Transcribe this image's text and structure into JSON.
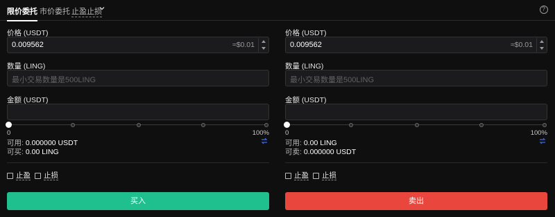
{
  "tabs": {
    "limit": "限价委托",
    "market": "市价委托",
    "stop": "止盈止损"
  },
  "buy": {
    "price_label": "价格 (USDT)",
    "price_value": "0.009562",
    "price_approx": "≈$0.01",
    "amount_label": "数量 (LING)",
    "amount_placeholder": "最小交易数量是500LING",
    "total_label": "金额 (USDT)",
    "total_value": "",
    "slider_min": "0",
    "slider_max": "100%",
    "slider_level": 0,
    "available_label": "可用:",
    "available_value": "0.000000 USDT",
    "can_label": "可买:",
    "can_value": "0.00 LING",
    "take_profit": "止盈",
    "stop_loss": "止损",
    "button": "买入"
  },
  "sell": {
    "price_label": "价格 (USDT)",
    "price_value": "0.009562",
    "price_approx": "≈$0.01",
    "amount_label": "数量 (LING)",
    "amount_placeholder": "最小交易数量是500LING",
    "total_label": "金额 (USDT)",
    "total_value": "",
    "slider_min": "0",
    "slider_max": "100%",
    "slider_level": 0,
    "available_label": "可用:",
    "available_value": "0.00 LING",
    "can_label": "可卖:",
    "can_value": "0.000000 USDT",
    "take_profit": "止盈",
    "stop_loss": "止损",
    "button": "卖出"
  },
  "colors": {
    "buy": "#1fc08d",
    "sell": "#e9473e",
    "background": "#0f0f10",
    "swap_icon": "#3b6cf0"
  },
  "icons": {
    "stop_dropdown": "chevron-down-icon",
    "help": "help-circle-icon",
    "swap": "swap-icon"
  }
}
